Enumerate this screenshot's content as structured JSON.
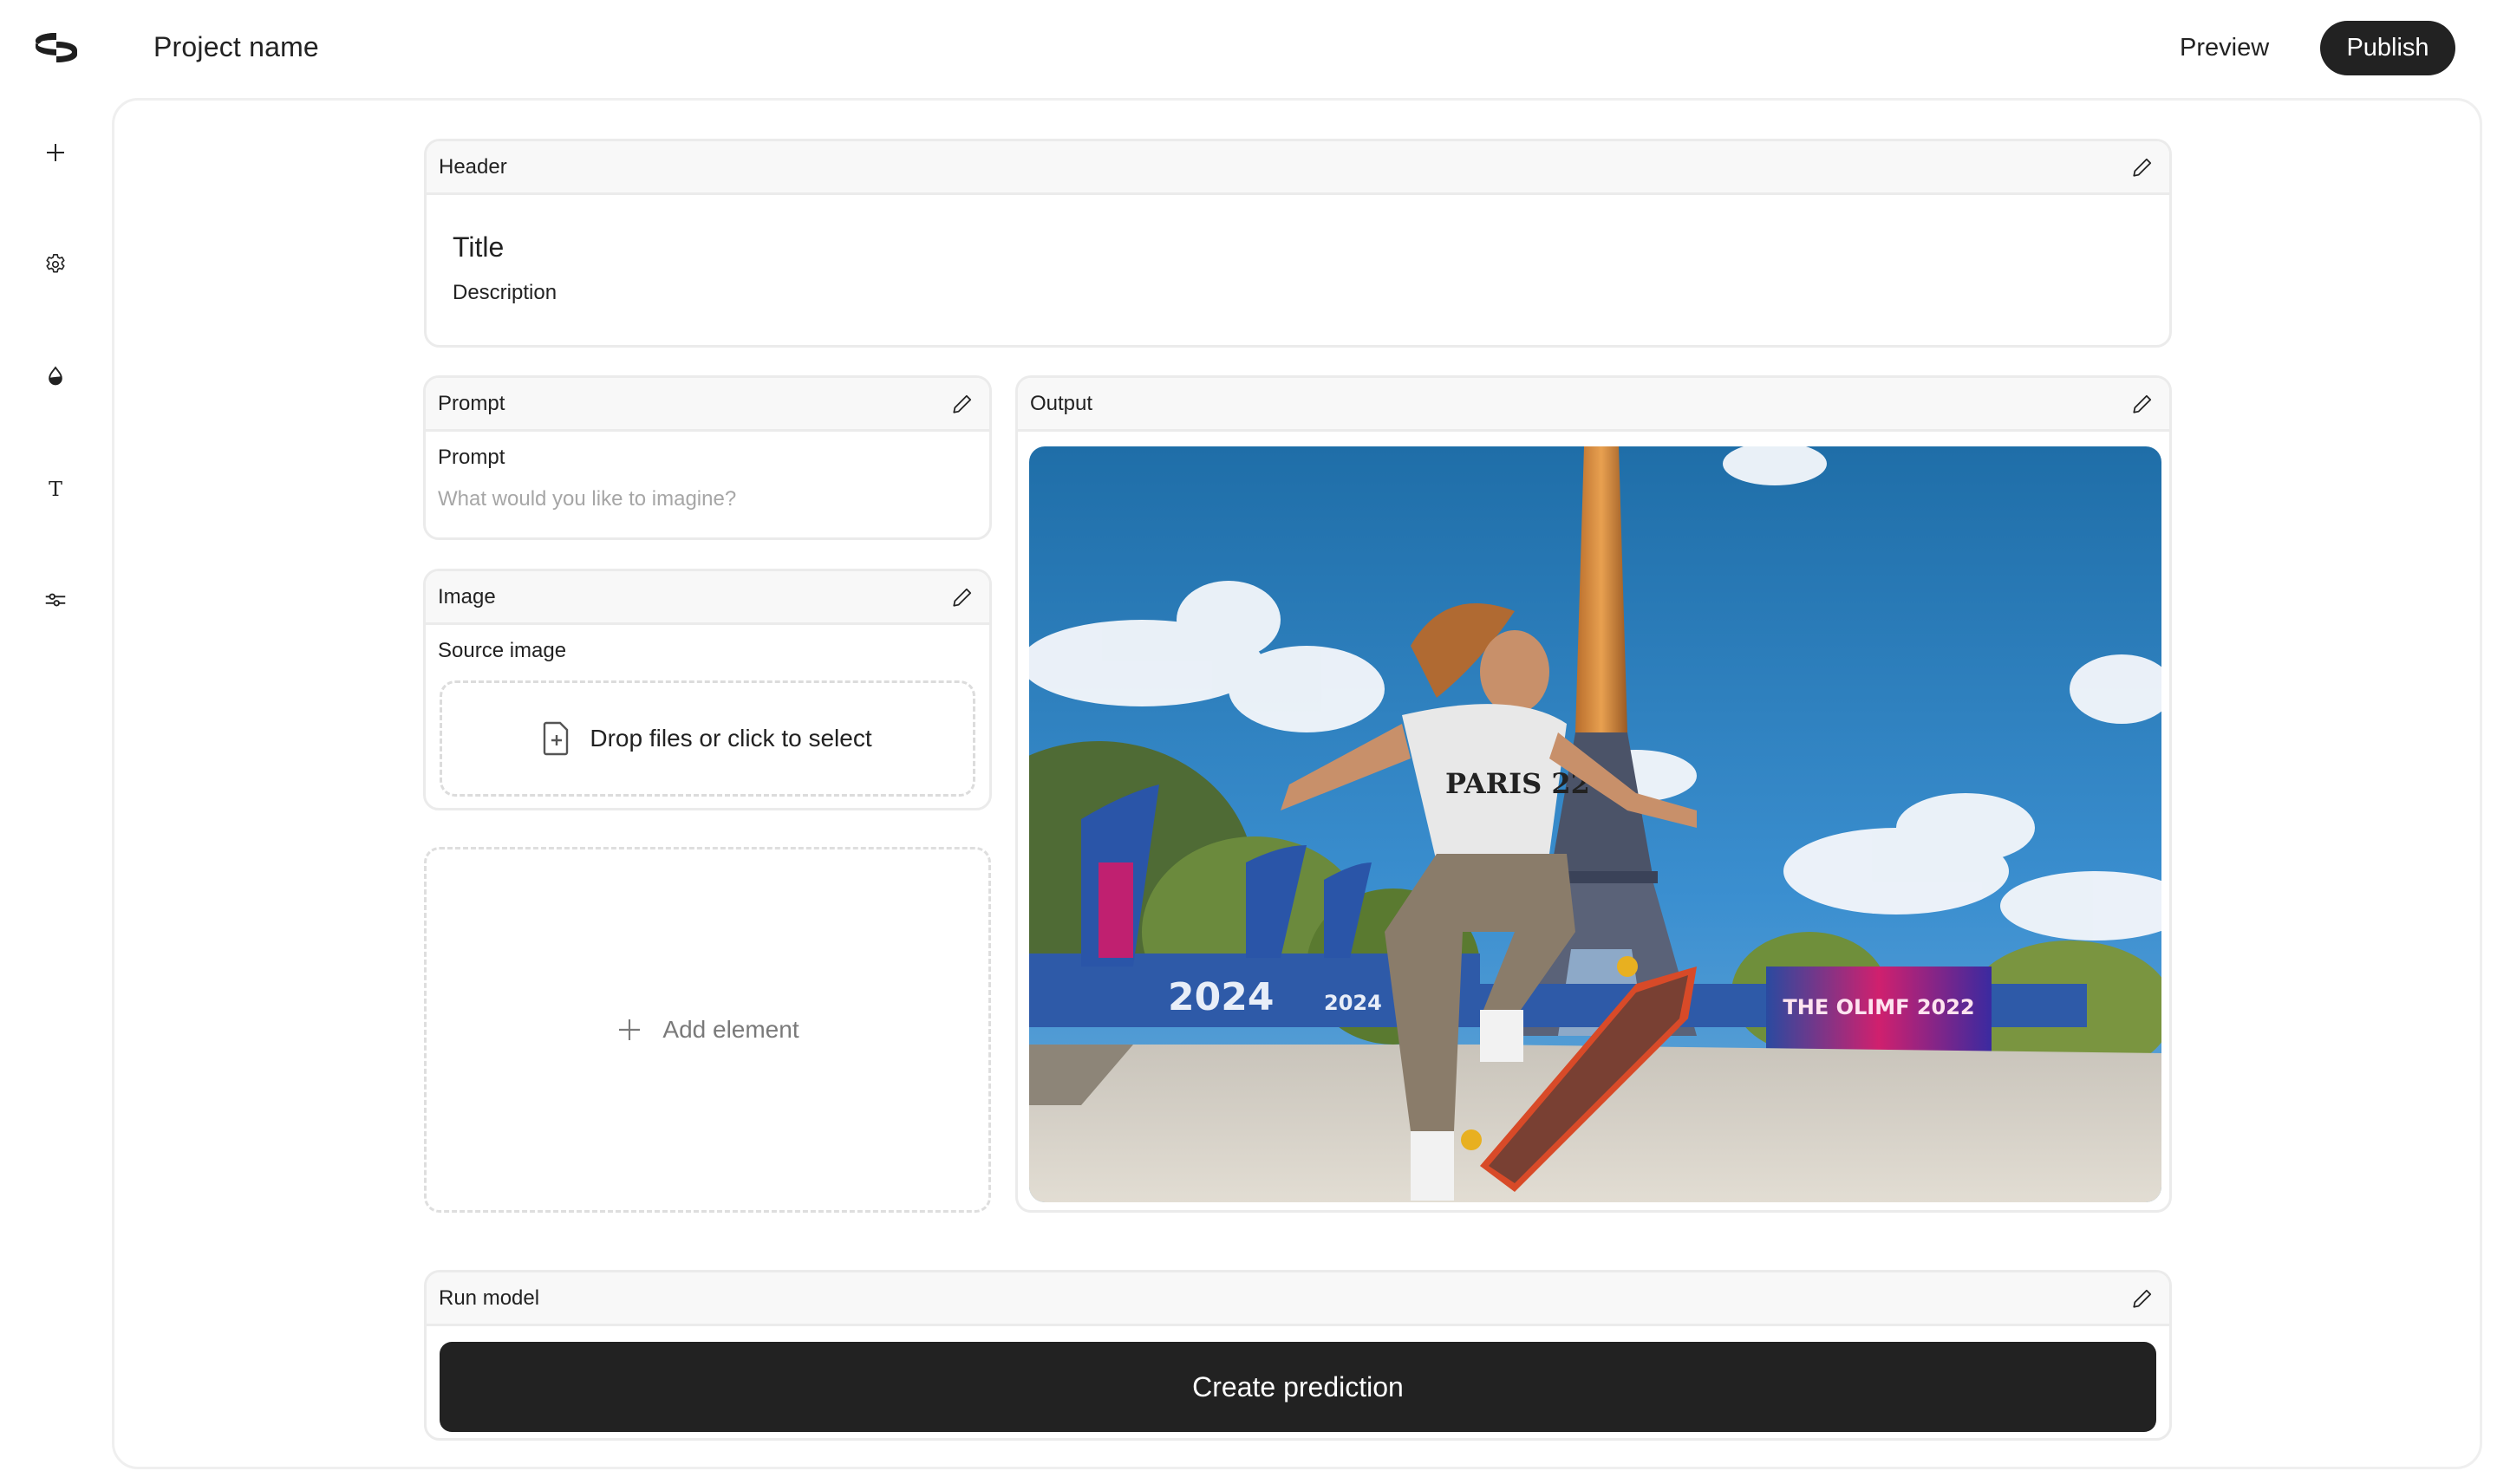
{
  "app": {
    "logo_icon": "replicate-ring-logo-icon",
    "project_name": "Project name"
  },
  "topbar": {
    "preview_label": "Preview",
    "publish_label": "Publish"
  },
  "sidebar": {
    "items": [
      {
        "name": "add",
        "icon": "plus-icon"
      },
      {
        "name": "settings",
        "icon": "gear-icon"
      },
      {
        "name": "theme",
        "icon": "droplet-icon"
      },
      {
        "name": "typography",
        "icon": "text-icon"
      },
      {
        "name": "adjustments",
        "icon": "sliders-icon"
      }
    ]
  },
  "cards": {
    "header": {
      "label": "Header",
      "title": "Title",
      "description": "Description",
      "edit_icon": "pencil-icon"
    },
    "prompt": {
      "label": "Prompt",
      "field_label": "Prompt",
      "value": "",
      "placeholder": "What would you like to imagine?",
      "edit_icon": "pencil-icon"
    },
    "image": {
      "label": "Image",
      "field_label": "Source image",
      "dropzone_text": "Drop files or click to select",
      "dropzone_icon": "file-plus-icon",
      "edit_icon": "pencil-icon"
    },
    "output": {
      "label": "Output",
      "edit_icon": "pencil-icon",
      "image_alt": "Skateboarder jumping in front of the Eiffel Tower",
      "image_texts": {
        "shirt": "PARIS 22",
        "barrier": "2024",
        "barrier_small": "2024",
        "banner": "THE OLIMF 2022"
      }
    },
    "add_element": {
      "label": "Add element",
      "icon": "plus-icon"
    },
    "run_model": {
      "label": "Run model",
      "button_label": "Create prediction",
      "edit_icon": "pencil-icon"
    }
  },
  "colors": {
    "primary_button": "#222222",
    "card_header_bg": "#f8f8f8",
    "border": "#ebebeb",
    "placeholder": "#a6a6a6",
    "muted_text": "#7a7a7a"
  }
}
